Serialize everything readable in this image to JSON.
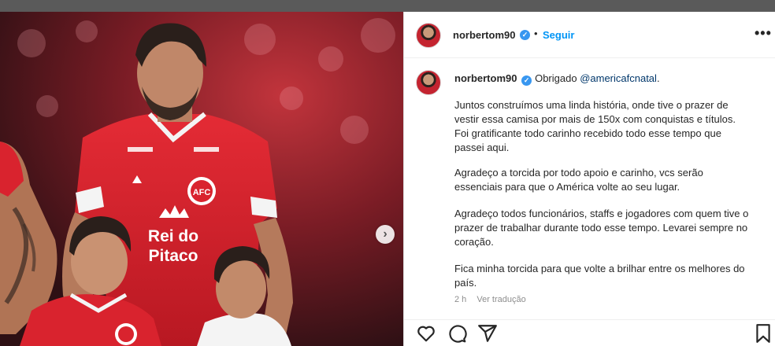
{
  "post": {
    "username": "norbertom90",
    "follow_label": "Seguir",
    "separator": "•",
    "more_label": "•••",
    "caption": {
      "username": "norbertom90",
      "intro": "Obrigado ",
      "mention": "@americafcnatal",
      "intro_end": ".",
      "paragraphs": [
        "Juntos construímos uma linda história, onde tive o prazer de\nvestir essa camisa por mais de 150x com conquistas e títulos.\nFoi gratificante todo carinho recebido todo esse tempo que\npassei aqui.",
        "Agradeço a torcida por todo apoio e carinho, vcs serão\nessenciais para que o América volte ao seu lugar.",
        "Agradeço todos funcionários, staffs e jogadores com quem tive o\nprazer de trabalhar durante todo esse tempo. Levarei sempre no\ncoração.",
        "Fica minha torcida para que volte a brilhar entre os melhores do\npaís."
      ]
    },
    "time_ago": "2 h",
    "translate_label": "Ver tradução"
  },
  "photo": {
    "sponsor_line1": "Rei do",
    "sponsor_line2": "Pitaco",
    "crest_text": "AFC",
    "next_label": "›"
  },
  "colors": {
    "accent": "#0095f6",
    "verified": "#3897f0",
    "jersey": "#d9232e"
  }
}
